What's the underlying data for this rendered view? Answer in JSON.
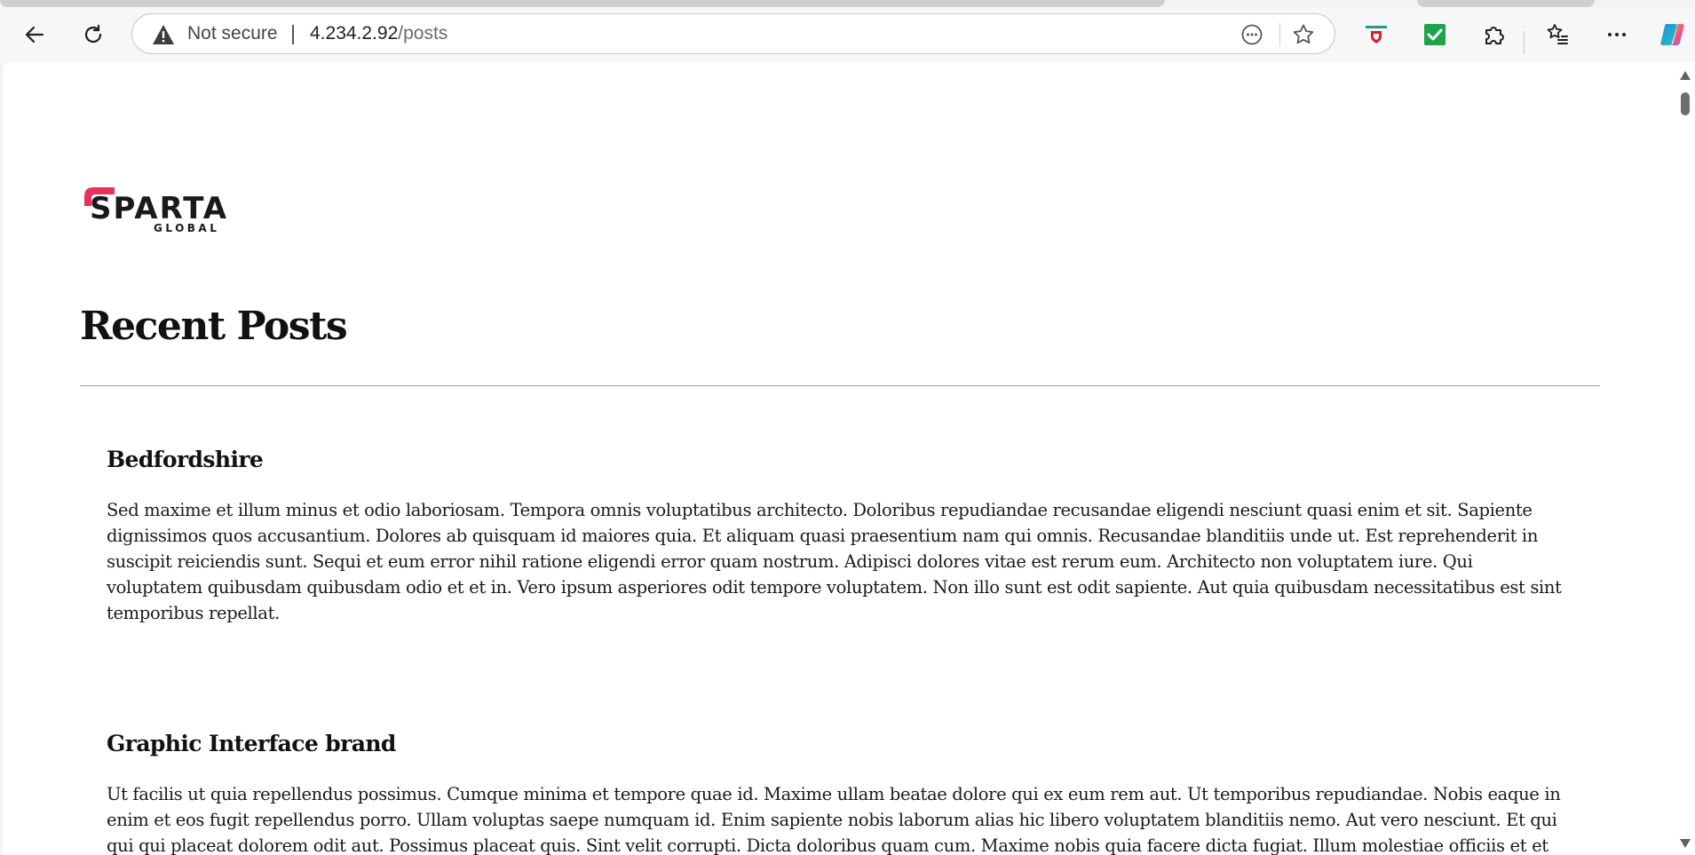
{
  "browser": {
    "security_label": "Not secure",
    "url_host": "4.234.2.92",
    "url_path": "/posts",
    "icons": {
      "back": "back-arrow-icon",
      "refresh": "refresh-icon",
      "warning": "warning-triangle-icon",
      "read_aloud": "more-circle-icon",
      "favorite": "star-icon",
      "ext_shield": "shield-extension-icon",
      "ext_check": "checkmark-extension-icon",
      "extensions": "puzzle-icon",
      "favorites": "favorites-list-icon",
      "menu": "ellipsis-icon",
      "copilot": "copilot-icon"
    },
    "colors": {
      "check_green": "#1ea34a",
      "shield_red": "#d61f35",
      "shield_teal": "#1e9e8a"
    }
  },
  "page": {
    "logo": {
      "brand": "SPARTA",
      "sub": "GLOBAL",
      "accent": "#e8315b"
    },
    "title": "Recent Posts",
    "posts": [
      {
        "title": "Bedfordshire",
        "body": "Sed maxime et illum minus et odio laboriosam. Tempora omnis voluptatibus architecto. Doloribus repudiandae recusandae eligendi nesciunt quasi enim et sit. Sapiente dignissimos quos accusantium. Dolores ab quisquam id maiores quia. Et aliquam quasi praesentium nam qui omnis. Recusandae blanditiis unde ut. Est reprehenderit in suscipit reiciendis sunt. Sequi et eum error nihil ratione eligendi error quam nostrum. Adipisci dolores vitae est rerum eum. Architecto non voluptatem iure. Qui voluptatem quibusdam quibusdam odio et et in. Vero ipsum asperiores odit tempore voluptatem. Non illo sunt est odit sapiente. Aut quia quibusdam necessitatibus est sint temporibus repellat."
      },
      {
        "title": "Graphic Interface brand",
        "body": "Ut facilis ut quia repellendus possimus. Cumque minima et tempore quae id. Maxime ullam beatae dolore qui ex eum rem aut. Ut temporibus repudiandae. Nobis eaque in enim et eos fugit repellendus porro. Ullam voluptas saepe numquam id. Enim sapiente nobis laborum alias hic libero voluptatem blanditiis nemo. Aut vero nesciunt. Et qui qui qui placeat dolorem odit aut. Possimus placeat quis. Sint velit corrupti. Dicta doloribus quam cum. Maxime nobis quia facere dicta fugiat. Illum molestiae officiis et et rerum."
      }
    ]
  }
}
